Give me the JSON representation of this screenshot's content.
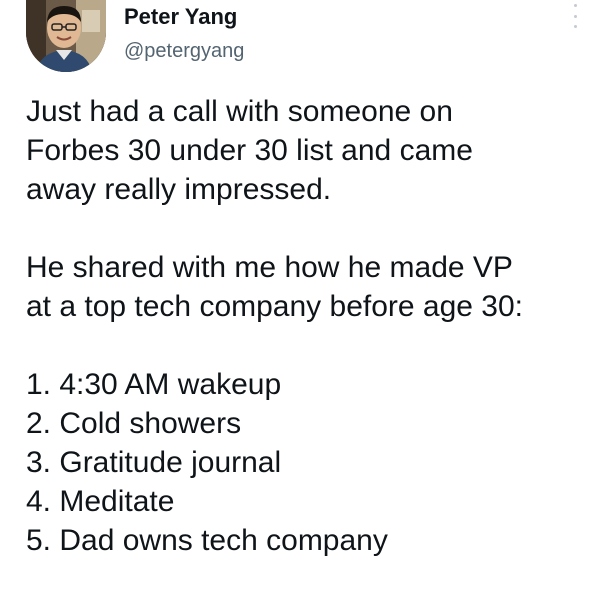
{
  "author": {
    "name": "Peter Yang",
    "handle": "@petergyang"
  },
  "tweet": {
    "paragraph1": [
      "Just had a call with someone on",
      "Forbes 30 under 30 list and came",
      "away really impressed."
    ],
    "paragraph2": [
      "He shared with me how he made VP",
      "at a top tech company before age 30:"
    ],
    "list": [
      "1. 4:30 AM wakeup",
      "2. Cold showers",
      "3. Gratitude journal",
      "4. Meditate",
      "5. Dad owns tech company"
    ]
  },
  "icons": {
    "more": "more-options-icon",
    "avatar": "profile-avatar"
  }
}
